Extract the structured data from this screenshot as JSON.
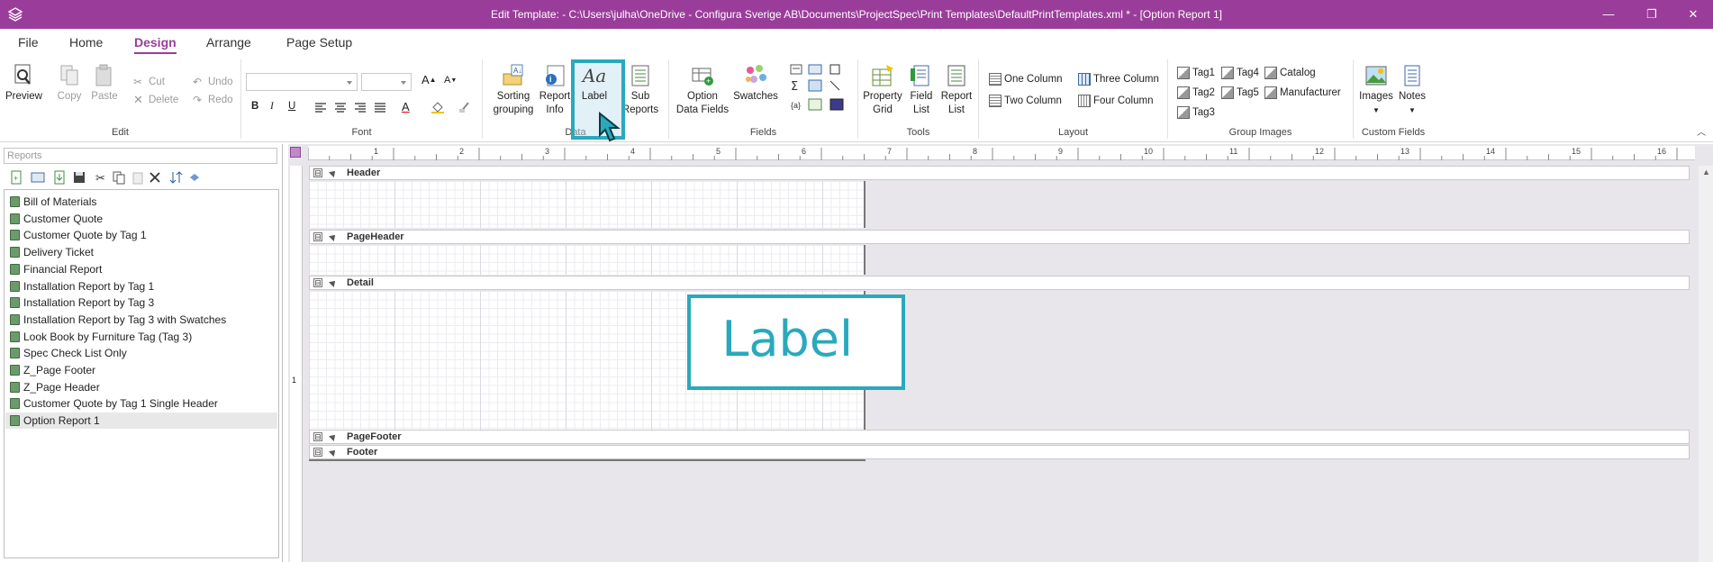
{
  "titlebar": {
    "title": "Edit Template:  - C:\\Users\\julha\\OneDrive - Configura Sverige AB\\Documents\\ProjectSpec\\Print Templates\\DefaultPrintTemplates.xml * - [Option Report 1]",
    "minimize": "—",
    "restore": "❐",
    "close": "✕",
    "color": "#9a3d9a"
  },
  "menu": {
    "tabs": [
      {
        "label": "File"
      },
      {
        "label": "Home"
      },
      {
        "label": "Design",
        "active": true
      },
      {
        "label": "Arrange"
      },
      {
        "label": "Page Setup"
      }
    ]
  },
  "ribbon": {
    "edit": {
      "label": "Edit",
      "preview": "Preview",
      "copy": "Copy",
      "paste": "Paste",
      "cut": "Cut",
      "delete": "Delete",
      "undo": "Undo",
      "redo": "Redo"
    },
    "font": {
      "label": "Font",
      "bold": "B",
      "italic": "I",
      "underline": "U",
      "grow": "A",
      "shrink": "A",
      "font_color": "A"
    },
    "data": {
      "label": "Data",
      "sorting_line1": "Sorting",
      "sorting_line2": "grouping",
      "report_line1": "Report",
      "report_line2": "Info",
      "label_btn": "Label",
      "label_icon_text": "Aa",
      "sub_line1": "Sub",
      "sub_line2": "Reports"
    },
    "fields": {
      "label": "Fields",
      "option_line1": "Option",
      "option_line2": "Data Fields",
      "swatches": "Swatches"
    },
    "tools": {
      "label": "Tools",
      "property_line1": "Property",
      "property_line2": "Grid",
      "field_line1": "Field",
      "field_line2": "List",
      "report_line1": "Report",
      "report_line2": "List"
    },
    "layout": {
      "label": "Layout",
      "one_column": "One Column",
      "two_column": "Two Column",
      "three_column": "Three Column",
      "four_column": "Four Column"
    },
    "group_images": {
      "label": "Group Images",
      "tag1": "Tag1",
      "tag2": "Tag2",
      "tag3": "Tag3",
      "tag4": "Tag4",
      "tag5": "Tag5",
      "catalog": "Catalog",
      "manufacturer": "Manufacturer"
    },
    "custom_fields": {
      "label": "Custom Fields",
      "images": "Images",
      "notes": "Notes"
    },
    "accent": "#2aa9bc"
  },
  "reports_panel": {
    "search_placeholder": "Reports",
    "items": [
      {
        "label": "Bill of Materials"
      },
      {
        "label": "Customer Quote"
      },
      {
        "label": "Customer Quote by Tag 1"
      },
      {
        "label": "Delivery Ticket"
      },
      {
        "label": "Financial Report"
      },
      {
        "label": "Installation Report by Tag 1"
      },
      {
        "label": "Installation Report by Tag 3"
      },
      {
        "label": "Installation Report by Tag 3 with Swatches"
      },
      {
        "label": "Look Book by Furniture Tag (Tag 3)"
      },
      {
        "label": "Spec Check List Only"
      },
      {
        "label": "Z_Page Footer"
      },
      {
        "label": "Z_Page Header"
      },
      {
        "label": "Customer Quote by Tag 1 Single Header"
      },
      {
        "label": "Option Report 1",
        "selected": true
      }
    ]
  },
  "designer": {
    "ruler_numbers": [
      "1",
      "2",
      "3",
      "4",
      "5",
      "6",
      "7",
      "8",
      "9",
      "10",
      "11",
      "12",
      "13",
      "14",
      "15",
      "16"
    ],
    "left_ruler_number": "1",
    "bands": {
      "header": "Header",
      "page_header": "PageHeader",
      "detail": "Detail",
      "page_footer": "PageFooter",
      "footer": "Footer"
    },
    "collapse_glyph": "⊟",
    "callout_label": "Label"
  }
}
